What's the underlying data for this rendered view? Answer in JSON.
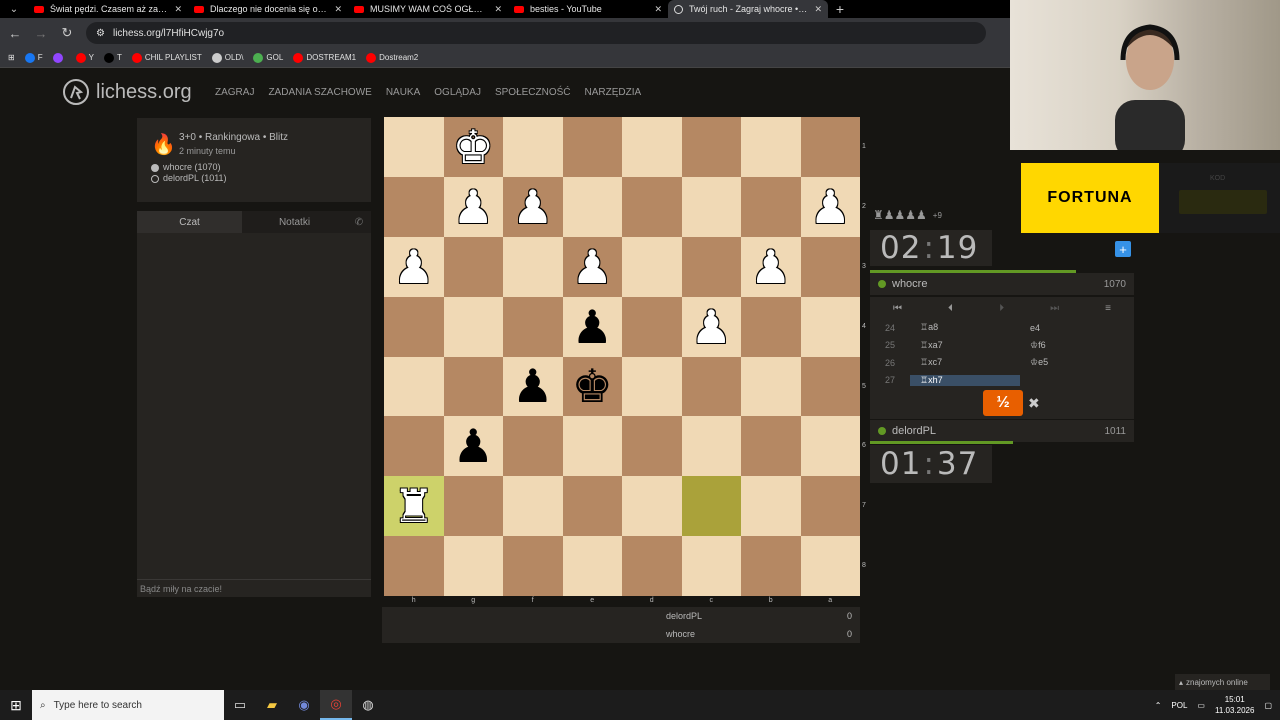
{
  "browser": {
    "tabs": [
      {
        "title": "Świat pędzi. Czasem aż za bardzo",
        "icon": "youtube-icon",
        "active": false
      },
      {
        "title": "Dlaczego nie docenia się ojcostwa",
        "icon": "youtube-icon",
        "active": false
      },
      {
        "title": "MUSIMY WAM COŚ OGŁOSIĆ",
        "icon": "youtube-icon",
        "active": false
      },
      {
        "title": "besties - YouTube",
        "icon": "youtube-icon",
        "active": false
      },
      {
        "title": "Twój ruch - Zagraj whocre • lichess",
        "icon": "lichess-icon",
        "active": true
      }
    ],
    "url": "lichess.org/l7HfiHCwjg7o",
    "bookmarks": [
      {
        "label": "F",
        "color": "#1877f2"
      },
      {
        "label": "",
        "color": "#9146ff"
      },
      {
        "label": "Y",
        "color": "#ff0000"
      },
      {
        "label": "T",
        "color": "#000000"
      },
      {
        "label": "CHIL PLAYLIST",
        "color": "#ff0000"
      },
      {
        "label": "OLD\\",
        "color": "#cccccc"
      },
      {
        "label": "GOL",
        "color": "#4caf50"
      },
      {
        "label": "DOSTREAM1",
        "color": "#ff0000"
      },
      {
        "label": "Dostream2",
        "color": "#ff0000"
      }
    ]
  },
  "site": {
    "logo": "lichess.org",
    "nav": [
      "ZAGRAJ",
      "ZADANIA SZACHOWE",
      "NAUKA",
      "OGLĄDAJ",
      "SPOŁECZNOŚĆ",
      "NARZĘDZIA"
    ]
  },
  "game_info": {
    "title": "3+0 • Rankingowa • Blitz",
    "time_ago": "2 minuty temu",
    "white_player": "whocre (1070)",
    "black_player": "delordPL (1011)"
  },
  "chat": {
    "tab_chat": "Czat",
    "tab_notes": "Notatki",
    "placeholder": "Bądź miły na czacie!"
  },
  "board": {
    "ranks": [
      "1",
      "2",
      "3",
      "4",
      "5",
      "6",
      "7",
      "8"
    ],
    "files": [
      "h",
      "g",
      "f",
      "e",
      "d",
      "c",
      "b",
      "a"
    ],
    "pieces": [
      [
        "",
        "K",
        "",
        "",
        "",
        "",
        "",
        ""
      ],
      [
        "",
        "P",
        "P",
        "",
        "",
        "",
        "",
        "P"
      ],
      [
        "P",
        "",
        "",
        "P",
        "",
        "",
        "P",
        ""
      ],
      [
        "",
        "",
        "",
        "p",
        "",
        "P",
        "",
        ""
      ],
      [
        "",
        "",
        "p",
        "k",
        "",
        "",
        "",
        ""
      ],
      [
        "",
        "p",
        "",
        "",
        "",
        "",
        "",
        ""
      ],
      [
        "R",
        "",
        "",
        "",
        "",
        "",
        "",
        ""
      ],
      [
        "",
        "",
        "",
        "",
        "",
        "",
        "",
        ""
      ]
    ],
    "highlights": [
      [
        6,
        0
      ],
      [
        6,
        5
      ]
    ]
  },
  "score": {
    "rows": [
      {
        "name": "delordPL",
        "score": "0"
      },
      {
        "name": "whocre",
        "score": "0"
      }
    ]
  },
  "right_panel": {
    "material_pieces": "♜♟♟♟♟",
    "material_diff": "+9",
    "top_clock": {
      "min": "02",
      "sec": "19"
    },
    "bottom_clock": {
      "min": "01",
      "sec": "37"
    },
    "top_player": {
      "name": "whocre",
      "rating": "1070"
    },
    "bottom_player": {
      "name": "delordPL",
      "rating": "1011"
    },
    "top_time_fraction": 0.78,
    "bottom_time_fraction": 0.54,
    "moves": [
      {
        "n": "24",
        "w": "♖a8",
        "b": "e4"
      },
      {
        "n": "25",
        "w": "♖xa7",
        "b": "♔f6"
      },
      {
        "n": "26",
        "w": "♖xc7",
        "b": "♔e5"
      },
      {
        "n": "27",
        "w": "♖xh7",
        "b": ""
      }
    ],
    "draw_offer": "½"
  },
  "overlay": {
    "sponsor": "FORTUNA",
    "sponsor_small": "",
    "kod_label": "KOD",
    "friends": "znajomych online"
  },
  "taskbar": {
    "search_placeholder": "Type here to search",
    "lang": "POL",
    "time": "15:01",
    "date": "11.03.2026"
  },
  "colors": {
    "accent_green": "#629924",
    "draw_orange": "#e85f00",
    "board_light": "#f0d9b5",
    "board_dark": "#b58863"
  }
}
